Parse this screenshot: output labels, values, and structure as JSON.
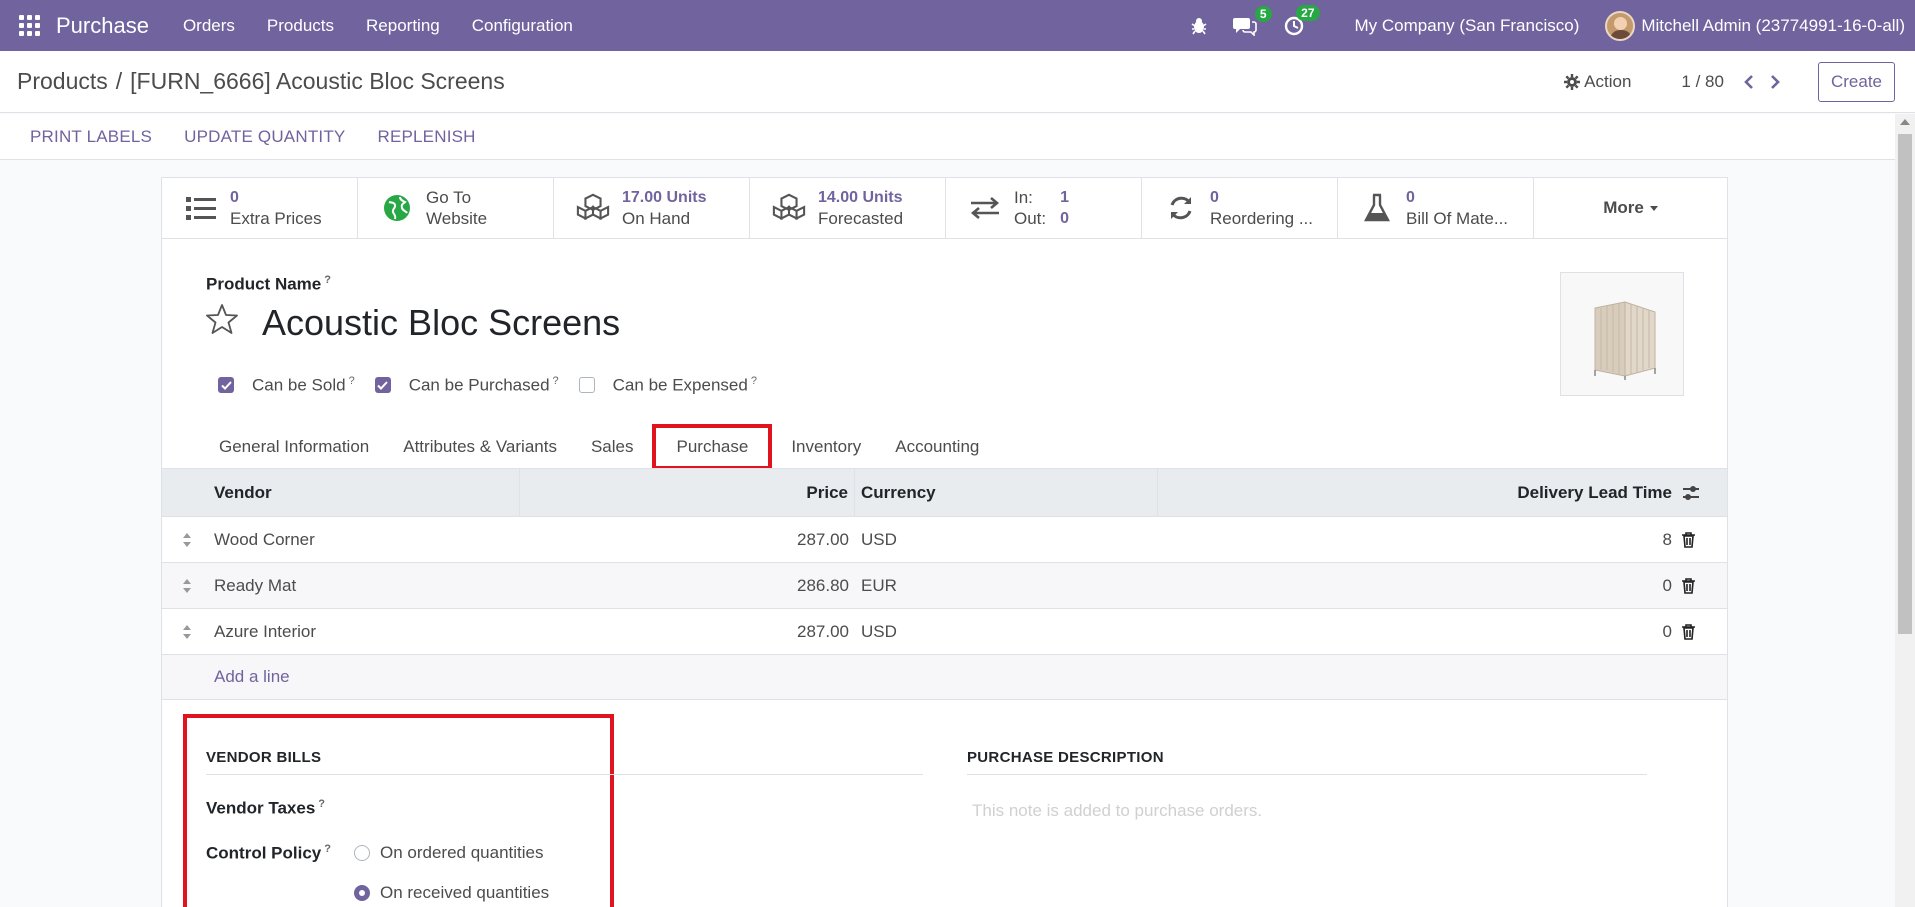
{
  "navbar": {
    "app_name": "Purchase",
    "menus": [
      "Orders",
      "Products",
      "Reporting",
      "Configuration"
    ],
    "messages_count": "5",
    "activities_count": "27",
    "company": "My Company (San Francisco)",
    "user": "Mitchell Admin (23774991-16-0-all)",
    "bg_color": "#71639e"
  },
  "breadcrumb": {
    "parent": "Products",
    "separator": "/",
    "current": "[FURN_6666] Acoustic Bloc Screens"
  },
  "control": {
    "action_label": "Action",
    "pager": "1 / 80",
    "create_label": "Create"
  },
  "action_buttons": [
    "PRINT LABELS",
    "UPDATE QUANTITY",
    "REPLENISH"
  ],
  "smart_buttons": {
    "extra_prices": {
      "value": "0",
      "label": "Extra Prices"
    },
    "website": {
      "line1": "Go To",
      "line2": "Website"
    },
    "on_hand": {
      "value": "17.00 Units",
      "label": "On Hand"
    },
    "forecasted": {
      "value": "14.00 Units",
      "label": "Forecasted"
    },
    "inout": {
      "in_label": "In:",
      "in_value": "1",
      "out_label": "Out:",
      "out_value": "0"
    },
    "reordering": {
      "value": "0",
      "label": "Reordering ..."
    },
    "bom": {
      "value": "0",
      "label": "Bill Of Mate..."
    },
    "more_label": "More"
  },
  "product": {
    "name_label": "Product Name",
    "name": "Acoustic Bloc Screens",
    "help_mark": "?",
    "can_be_sold": "Can be Sold",
    "can_be_purchased": "Can be Purchased",
    "can_be_expensed": "Can be Expensed"
  },
  "tabs": [
    "General Information",
    "Attributes & Variants",
    "Sales",
    "Purchase",
    "Inventory",
    "Accounting"
  ],
  "active_tab": "Purchase",
  "vendor_table": {
    "headers": {
      "vendor": "Vendor",
      "price": "Price",
      "currency": "Currency",
      "lead": "Delivery Lead Time"
    },
    "rows": [
      {
        "vendor": "Wood Corner",
        "price": "287.00",
        "currency": "USD",
        "lead": "8"
      },
      {
        "vendor": "Ready Mat",
        "price": "286.80",
        "currency": "EUR",
        "lead": "0"
      },
      {
        "vendor": "Azure Interior",
        "price": "287.00",
        "currency": "USD",
        "lead": "0"
      }
    ],
    "add_line": "Add a line"
  },
  "vendor_bills": {
    "title": "VENDOR BILLS",
    "taxes_label": "Vendor Taxes",
    "control_label": "Control Policy",
    "option_ordered": "On ordered quantities",
    "option_received": "On received quantities",
    "selected": "On received quantities"
  },
  "purchase_description": {
    "title": "PURCHASE DESCRIPTION",
    "placeholder": "This note is added to purchase orders."
  },
  "colors": {
    "accent": "#71639e",
    "highlight": "#e0141e",
    "badge": "#28a745"
  }
}
